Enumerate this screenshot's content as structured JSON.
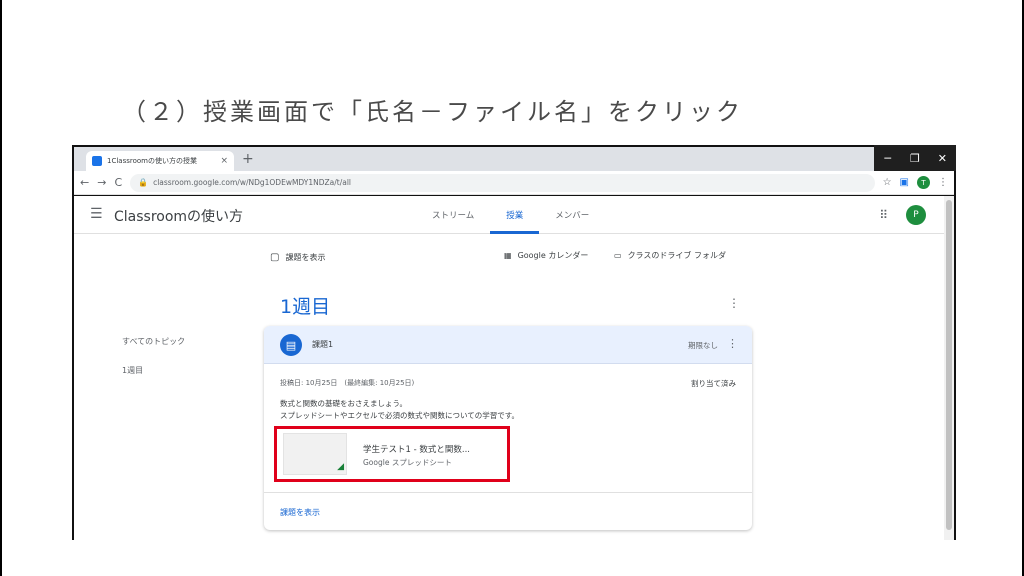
{
  "slide": {
    "title": "（２）授業画面で「氏名－ファイル名」をクリック"
  },
  "browser": {
    "tab_title": "1Classroomの使い方の授業",
    "tab_close": "×",
    "new_tab": "+",
    "url": "classroom.google.com/w/NDg1ODEwMDY1NDZa/t/all",
    "back": "←",
    "forward": "→",
    "reload": "C",
    "profile_initial": "T",
    "window_controls": [
      "─",
      "❐",
      "✕"
    ]
  },
  "app": {
    "class_name": "Classroomの使い方",
    "tabs": [
      {
        "label": "ストリーム",
        "active": false
      },
      {
        "label": "授業",
        "active": true
      },
      {
        "label": "メンバー",
        "active": false
      }
    ],
    "avatar_initial": "P"
  },
  "classwork": {
    "view_work": "課題を表示",
    "calendar_link": "Google カレンダー",
    "drive_link": "クラスのドライブ フォルダ",
    "topics": [
      "すべてのトピック",
      "1週目"
    ],
    "topic_title": "1週目"
  },
  "assignment": {
    "title": "課題1",
    "due": "期限なし",
    "posted": "投稿日: 10月25日　(最終編集: 10月25日)",
    "status": "割り当て済み",
    "description_line1": "数式と関数の基礎をおさえましょう。",
    "description_line2": "スプレッドシートやエクセルで必須の数式や関数についての学習です。",
    "attachment_name": "学生テスト1 - 数式と関数...",
    "attachment_type": "Google スプレッドシート",
    "view_details": "課題を表示"
  },
  "colors": {
    "accent": "#1967d2",
    "highlight_box": "#e0001a",
    "sheets_green": "#188038"
  }
}
